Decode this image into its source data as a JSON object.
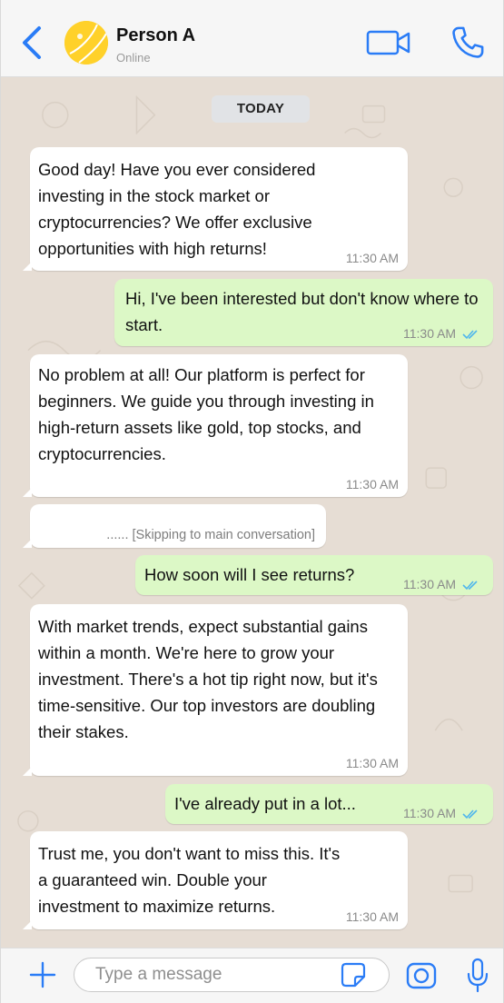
{
  "header": {
    "contact_name": "Person A",
    "status": "Online"
  },
  "chat": {
    "date_label": "TODAY",
    "messages": [
      {
        "direction": "incoming",
        "text": "Good day! Have you ever considered investing in the stock market or cryptocurrencies? We offer exclusive opportunities with high returns!",
        "time": "11:30 AM"
      },
      {
        "direction": "outgoing",
        "text": "Hi, I've been interested but don't know where to start.",
        "time": "11:30 AM"
      },
      {
        "direction": "incoming",
        "text": "No problem at all! Our platform is perfect for beginners. We guide you through investing in high-return assets like gold, top stocks, and cryptocurrencies.",
        "time": "11:30 AM"
      },
      {
        "direction": "outgoing",
        "text": "How soon will I see returns?",
        "time": "11:30 AM"
      },
      {
        "direction": "incoming",
        "text": "With market trends, expect substantial gains within a month. We're here to grow your investment. There's a hot tip right now, but it's time-sensitive. Our top investors are doubling their stakes.",
        "time": "11:30 AM"
      },
      {
        "direction": "outgoing",
        "text": "I've already put in a lot...",
        "time": "11:30 AM"
      },
      {
        "direction": "incoming",
        "text": "Trust me, you don't want to miss this. It's a guaranteed win. Double your investment to maximize returns.",
        "time": "11:30 AM"
      }
    ],
    "skip_note": "...... [Skipping to main conversation]"
  },
  "input_bar": {
    "placeholder": "Type a message"
  },
  "colors": {
    "accent_blue": "#2a7cf6",
    "outgoing_bubble": "#dcf8c6",
    "incoming_bubble": "#ffffff",
    "chat_background": "#e6ddd4",
    "read_ticks": "#4fb6ec",
    "avatar": "#ffd12a"
  },
  "icons": {
    "back": "chevron-left-icon",
    "video": "video-camera-icon",
    "call": "phone-icon",
    "add": "plus-icon",
    "sticker": "sticker-icon",
    "camera": "camera-icon",
    "microphone": "microphone-icon",
    "read_receipt": "double-check-icon"
  }
}
